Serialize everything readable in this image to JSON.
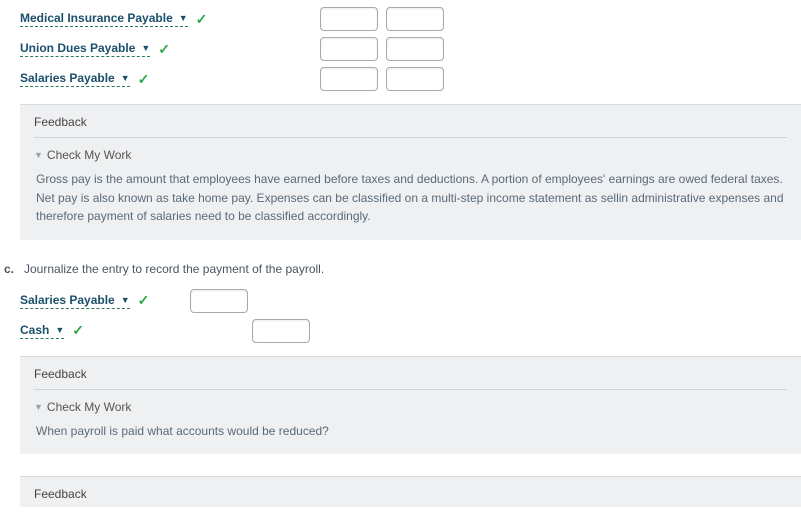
{
  "topRows": [
    {
      "label": "Medical Insurance Payable"
    },
    {
      "label": "Union Dues Payable"
    },
    {
      "label": "Salaries Payable"
    }
  ],
  "feedback1": {
    "title": "Feedback",
    "cmw": "Check My Work",
    "body": "Gross pay is the amount that employees have earned before taxes and deductions. A portion of employees' earnings are owed federal taxes. Net pay is also known as take home pay. Expenses can be classified on a multi-step income statement as sellin administrative expenses and therefore payment of salaries need to be classified accordingly."
  },
  "partC": {
    "letter": "c.",
    "prompt": "Journalize the entry to record the payment of the payroll.",
    "rows": [
      {
        "label": "Salaries Payable"
      },
      {
        "label": "Cash"
      }
    ]
  },
  "feedback2": {
    "title": "Feedback",
    "cmw": "Check My Work",
    "body": "When payroll is paid what accounts would be reduced?"
  },
  "feedback3": {
    "title": "Feedback"
  }
}
